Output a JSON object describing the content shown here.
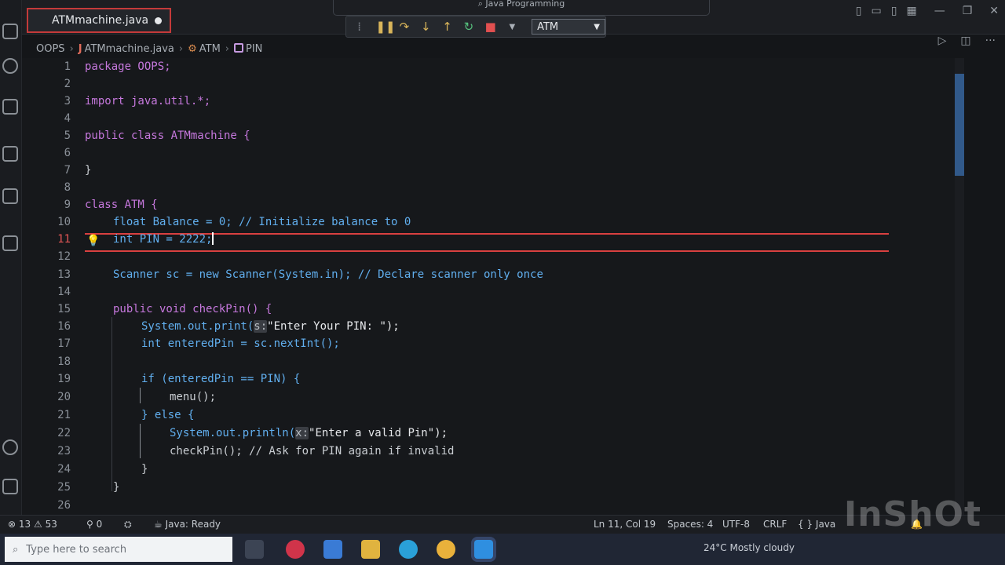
{
  "title_bar": {
    "file_tab": "ATMmachine.java",
    "window_title": "Java Programming"
  },
  "debug_toolbar": {
    "config_select": "ATM"
  },
  "breadcrumb": {
    "items": [
      "OOPS",
      "ATMmachine.java",
      "ATM",
      "PIN"
    ]
  },
  "editor": {
    "active_line": 11,
    "line_numbers": [
      "1",
      "2",
      "3",
      "4",
      "5",
      "6",
      "7",
      "8",
      "9",
      "10",
      "11",
      "12",
      "13",
      "14",
      "15",
      "16",
      "17",
      "18",
      "19",
      "20",
      "21",
      "22",
      "23",
      "24",
      "25",
      "26"
    ],
    "lines": {
      "l1": "package OOPS;",
      "l3": "import java.util.*;",
      "l5": "public class ATMmachine {",
      "l7": "}",
      "l9": "class ATM {",
      "l10": "float Balance = 0; // Initialize balance to 0",
      "l11": "int PIN = 2222;",
      "l13": "Scanner sc = new Scanner(System.in); // Declare scanner only once",
      "l15": "public void checkPin() {",
      "l16_pre": "System.out.print(",
      "l16_hint": "s:",
      "l16_post": "\"Enter Your PIN: \");",
      "l17": "int enteredPin = sc.nextInt();",
      "l19": "if (enteredPin == PIN) {",
      "l20": "menu();",
      "l21": "} else {",
      "l22_pre": "System.out.println(",
      "l22_hint": "x:",
      "l22_post": "\"Enter a valid Pin\");",
      "l23": "checkPin(); // Ask for PIN again if invalid",
      "l24": "}",
      "l25": "}"
    }
  },
  "status_bar": {
    "errors": "13",
    "warnings": "53",
    "ports": "0",
    "java_status": "Java: Ready",
    "position": "Ln 11, Col 19",
    "spaces": "Spaces: 4",
    "encoding": "UTF-8",
    "eol": "CRLF",
    "language": "{ } Java"
  },
  "taskbar": {
    "search_placeholder": "Type here to search",
    "weather": "24°C  Mostly cloudy"
  },
  "overlay": {
    "watermark": "InShOt"
  },
  "colors": {
    "accent": "#3b74b8",
    "error_highlight": "#d94040",
    "keyword": "#c678dd",
    "type": "#61afef"
  }
}
